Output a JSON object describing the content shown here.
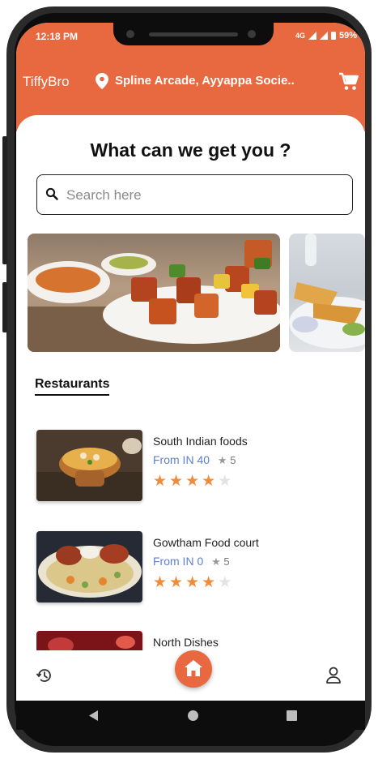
{
  "status_bar": {
    "time": "12:18 PM",
    "network": "4G",
    "battery": "59%"
  },
  "app_bar": {
    "brand": "TiffyBro",
    "location": "Spline Arcade, Ayyappa Socie..",
    "icons": [
      "location-pin-icon",
      "cart-icon"
    ]
  },
  "main": {
    "heading": "What can we get you ?",
    "search": {
      "placeholder": "Search here",
      "value": ""
    },
    "section_title": "Restaurants"
  },
  "restaurants": [
    {
      "name": "South Indian foods",
      "price": "From IN 40",
      "rating": "5",
      "stars": 4
    },
    {
      "name": "Gowtham Food court",
      "price": "From IN 0",
      "rating": "5",
      "stars": 4
    },
    {
      "name": "North Dishes",
      "price": "",
      "rating": "",
      "stars": 0
    }
  ],
  "bottom_nav": {
    "items": [
      "history-icon",
      "home-icon",
      "profile-icon"
    ],
    "active": "home-icon"
  },
  "colors": {
    "accent": "#e8693f",
    "price": "#5d7fd6",
    "star": "#ee8c3c"
  }
}
